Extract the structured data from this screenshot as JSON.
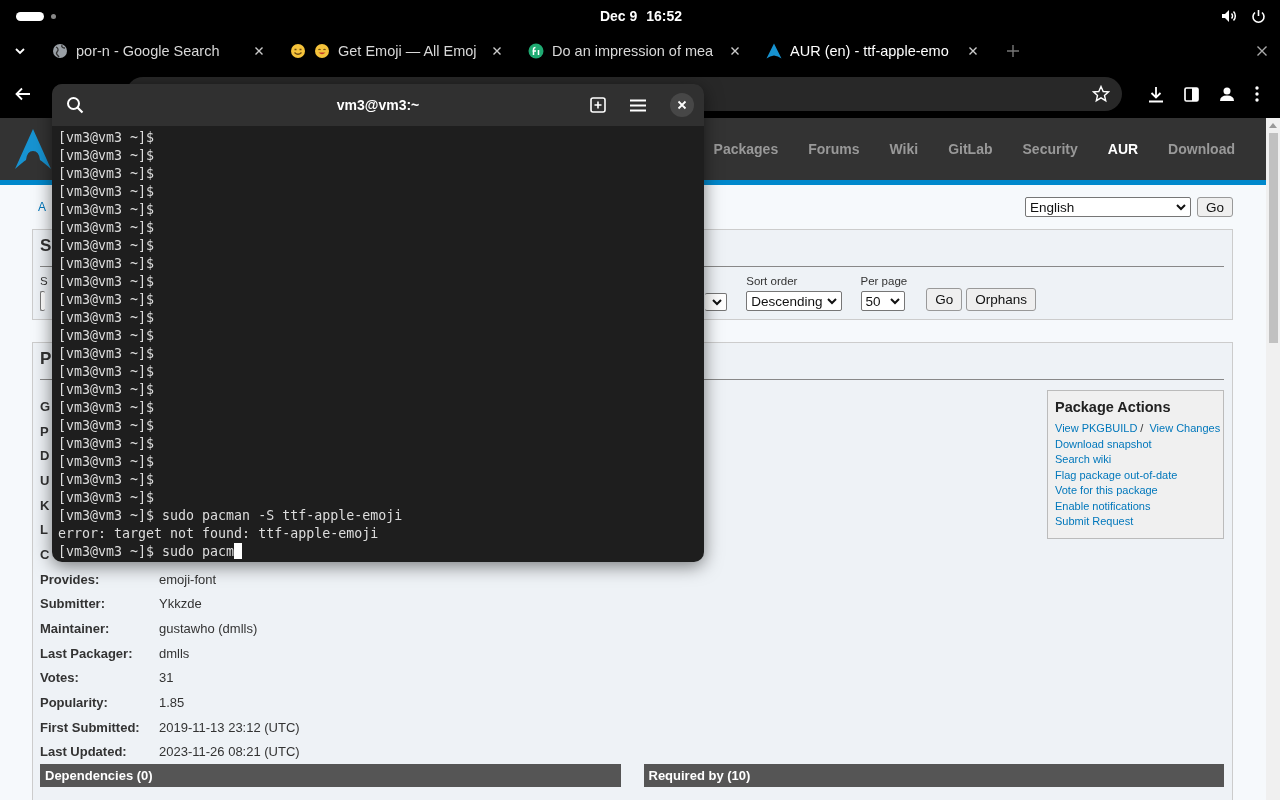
{
  "top_bar": {
    "date": "Dec 9",
    "time": "16:52"
  },
  "browser": {
    "tabs": [
      {
        "title": "por-n - Google Search",
        "kind": "globe",
        "selected": false
      },
      {
        "title": "Get Emoji — All Emoj",
        "kind": "smiley",
        "selected": false
      },
      {
        "title": "Do an impression of mea",
        "kind": "badge",
        "selected": false
      },
      {
        "title": "AUR (en) - ttf-apple-emo",
        "kind": "arch",
        "selected": true
      }
    ]
  },
  "page": {
    "nav": [
      {
        "label": "Packages",
        "selected": false
      },
      {
        "label": "Forums",
        "selected": false
      },
      {
        "label": "Wiki",
        "selected": false
      },
      {
        "label": "GitLab",
        "selected": false
      },
      {
        "label": "Security",
        "selected": false
      },
      {
        "label": "AUR",
        "selected": true
      },
      {
        "label": "Download",
        "selected": false
      }
    ],
    "breadcrumb": "A",
    "language": {
      "value": "English",
      "button": "Go"
    },
    "search": {
      "heading": "S",
      "field_label": "S",
      "sort_order": {
        "label": "Sort order",
        "value": "Descending"
      },
      "per_page": {
        "label": "Per page",
        "value": "50"
      },
      "buttons": [
        "Go",
        "Orphans"
      ]
    },
    "details": {
      "heading": "P",
      "rows": [
        {
          "label": "G"
        },
        {
          "label": "P"
        },
        {
          "label": "D"
        },
        {
          "label": "U"
        },
        {
          "label": "K"
        },
        {
          "label": "L"
        },
        {
          "label": "C"
        },
        {
          "label": "Provides:",
          "value": "emoji-font"
        },
        {
          "label": "Submitter:",
          "value": "Ykkzde"
        },
        {
          "label": "Maintainer:",
          "value": "gustawho (dmlls)"
        },
        {
          "label": "Last Packager:",
          "value": "dmlls"
        },
        {
          "label": "Votes:",
          "value": "31"
        },
        {
          "label": "Popularity:",
          "value": "1.85"
        },
        {
          "label": "First Submitted:",
          "value": "2019-11-13 23:12 (UTC)"
        },
        {
          "label": "Last Updated:",
          "value": "2023-11-26 08:21 (UTC)"
        }
      ]
    },
    "actions": {
      "heading": "Package Actions",
      "lines": [
        {
          "links": [
            "View PKGBUILD",
            "View Changes"
          ],
          "separator": "/"
        },
        {
          "links": [
            "Download snapshot"
          ]
        },
        {
          "links": [
            "Search wiki"
          ]
        },
        {
          "links": [
            "Flag package out-of-date"
          ]
        },
        {
          "links": [
            "Vote for this package"
          ]
        },
        {
          "links": [
            "Enable notifications"
          ]
        },
        {
          "links": [
            "Submit Request"
          ]
        }
      ]
    },
    "sections": [
      "Dependencies (0)",
      "Required by (10)"
    ]
  },
  "terminal": {
    "title": "vm3@vm3:~",
    "lines": [
      {
        "text": "[vm3@vm3 ~]$",
        "cursor": false
      },
      {
        "text": "[vm3@vm3 ~]$",
        "cursor": false
      },
      {
        "text": "[vm3@vm3 ~]$",
        "cursor": false
      },
      {
        "text": "[vm3@vm3 ~]$",
        "cursor": false
      },
      {
        "text": "[vm3@vm3 ~]$",
        "cursor": false
      },
      {
        "text": "[vm3@vm3 ~]$",
        "cursor": false
      },
      {
        "text": "[vm3@vm3 ~]$",
        "cursor": false
      },
      {
        "text": "[vm3@vm3 ~]$",
        "cursor": false
      },
      {
        "text": "[vm3@vm3 ~]$",
        "cursor": false
      },
      {
        "text": "[vm3@vm3 ~]$",
        "cursor": false
      },
      {
        "text": "[vm3@vm3 ~]$",
        "cursor": false
      },
      {
        "text": "[vm3@vm3 ~]$",
        "cursor": false
      },
      {
        "text": "[vm3@vm3 ~]$",
        "cursor": false
      },
      {
        "text": "[vm3@vm3 ~]$",
        "cursor": false
      },
      {
        "text": "[vm3@vm3 ~]$",
        "cursor": false
      },
      {
        "text": "[vm3@vm3 ~]$",
        "cursor": false
      },
      {
        "text": "[vm3@vm3 ~]$",
        "cursor": false
      },
      {
        "text": "[vm3@vm3 ~]$",
        "cursor": false
      },
      {
        "text": "[vm3@vm3 ~]$",
        "cursor": false
      },
      {
        "text": "[vm3@vm3 ~]$",
        "cursor": false
      },
      {
        "text": "[vm3@vm3 ~]$",
        "cursor": false
      },
      {
        "text": "[vm3@vm3 ~]$ sudo pacman -S ttf-apple-emoji",
        "cursor": false
      },
      {
        "text": "error: target not found: ttf-apple-emoji",
        "cursor": false
      },
      {
        "text": "[vm3@vm3 ~]$ sudo pacm",
        "cursor": true
      }
    ]
  }
}
